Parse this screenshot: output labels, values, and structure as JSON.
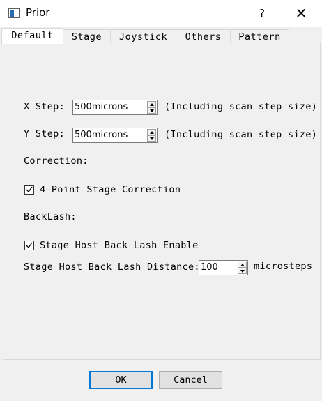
{
  "window": {
    "title": "Prior",
    "help": "?",
    "close": "✕"
  },
  "tabs": [
    "Default",
    "Stage",
    "Joystick",
    "Others",
    "Pattern"
  ],
  "active_tab": "Default",
  "x_step": {
    "label": "X Step:",
    "value": "500microns",
    "note": "(Including scan step size)"
  },
  "y_step": {
    "label": "Y Step:",
    "value": "500microns",
    "note": "(Including scan step size)"
  },
  "correction": {
    "heading": "Correction:",
    "checkbox_label": "4-Point Stage Correction",
    "checked": true
  },
  "backlash": {
    "heading": "BackLash:",
    "checkbox_label": "Stage Host Back Lash Enable",
    "checked": true,
    "distance_label": "Stage Host Back Lash Distance:",
    "distance_value": "100",
    "unit": "microsteps"
  },
  "buttons": {
    "ok": "OK",
    "cancel": "Cancel"
  }
}
